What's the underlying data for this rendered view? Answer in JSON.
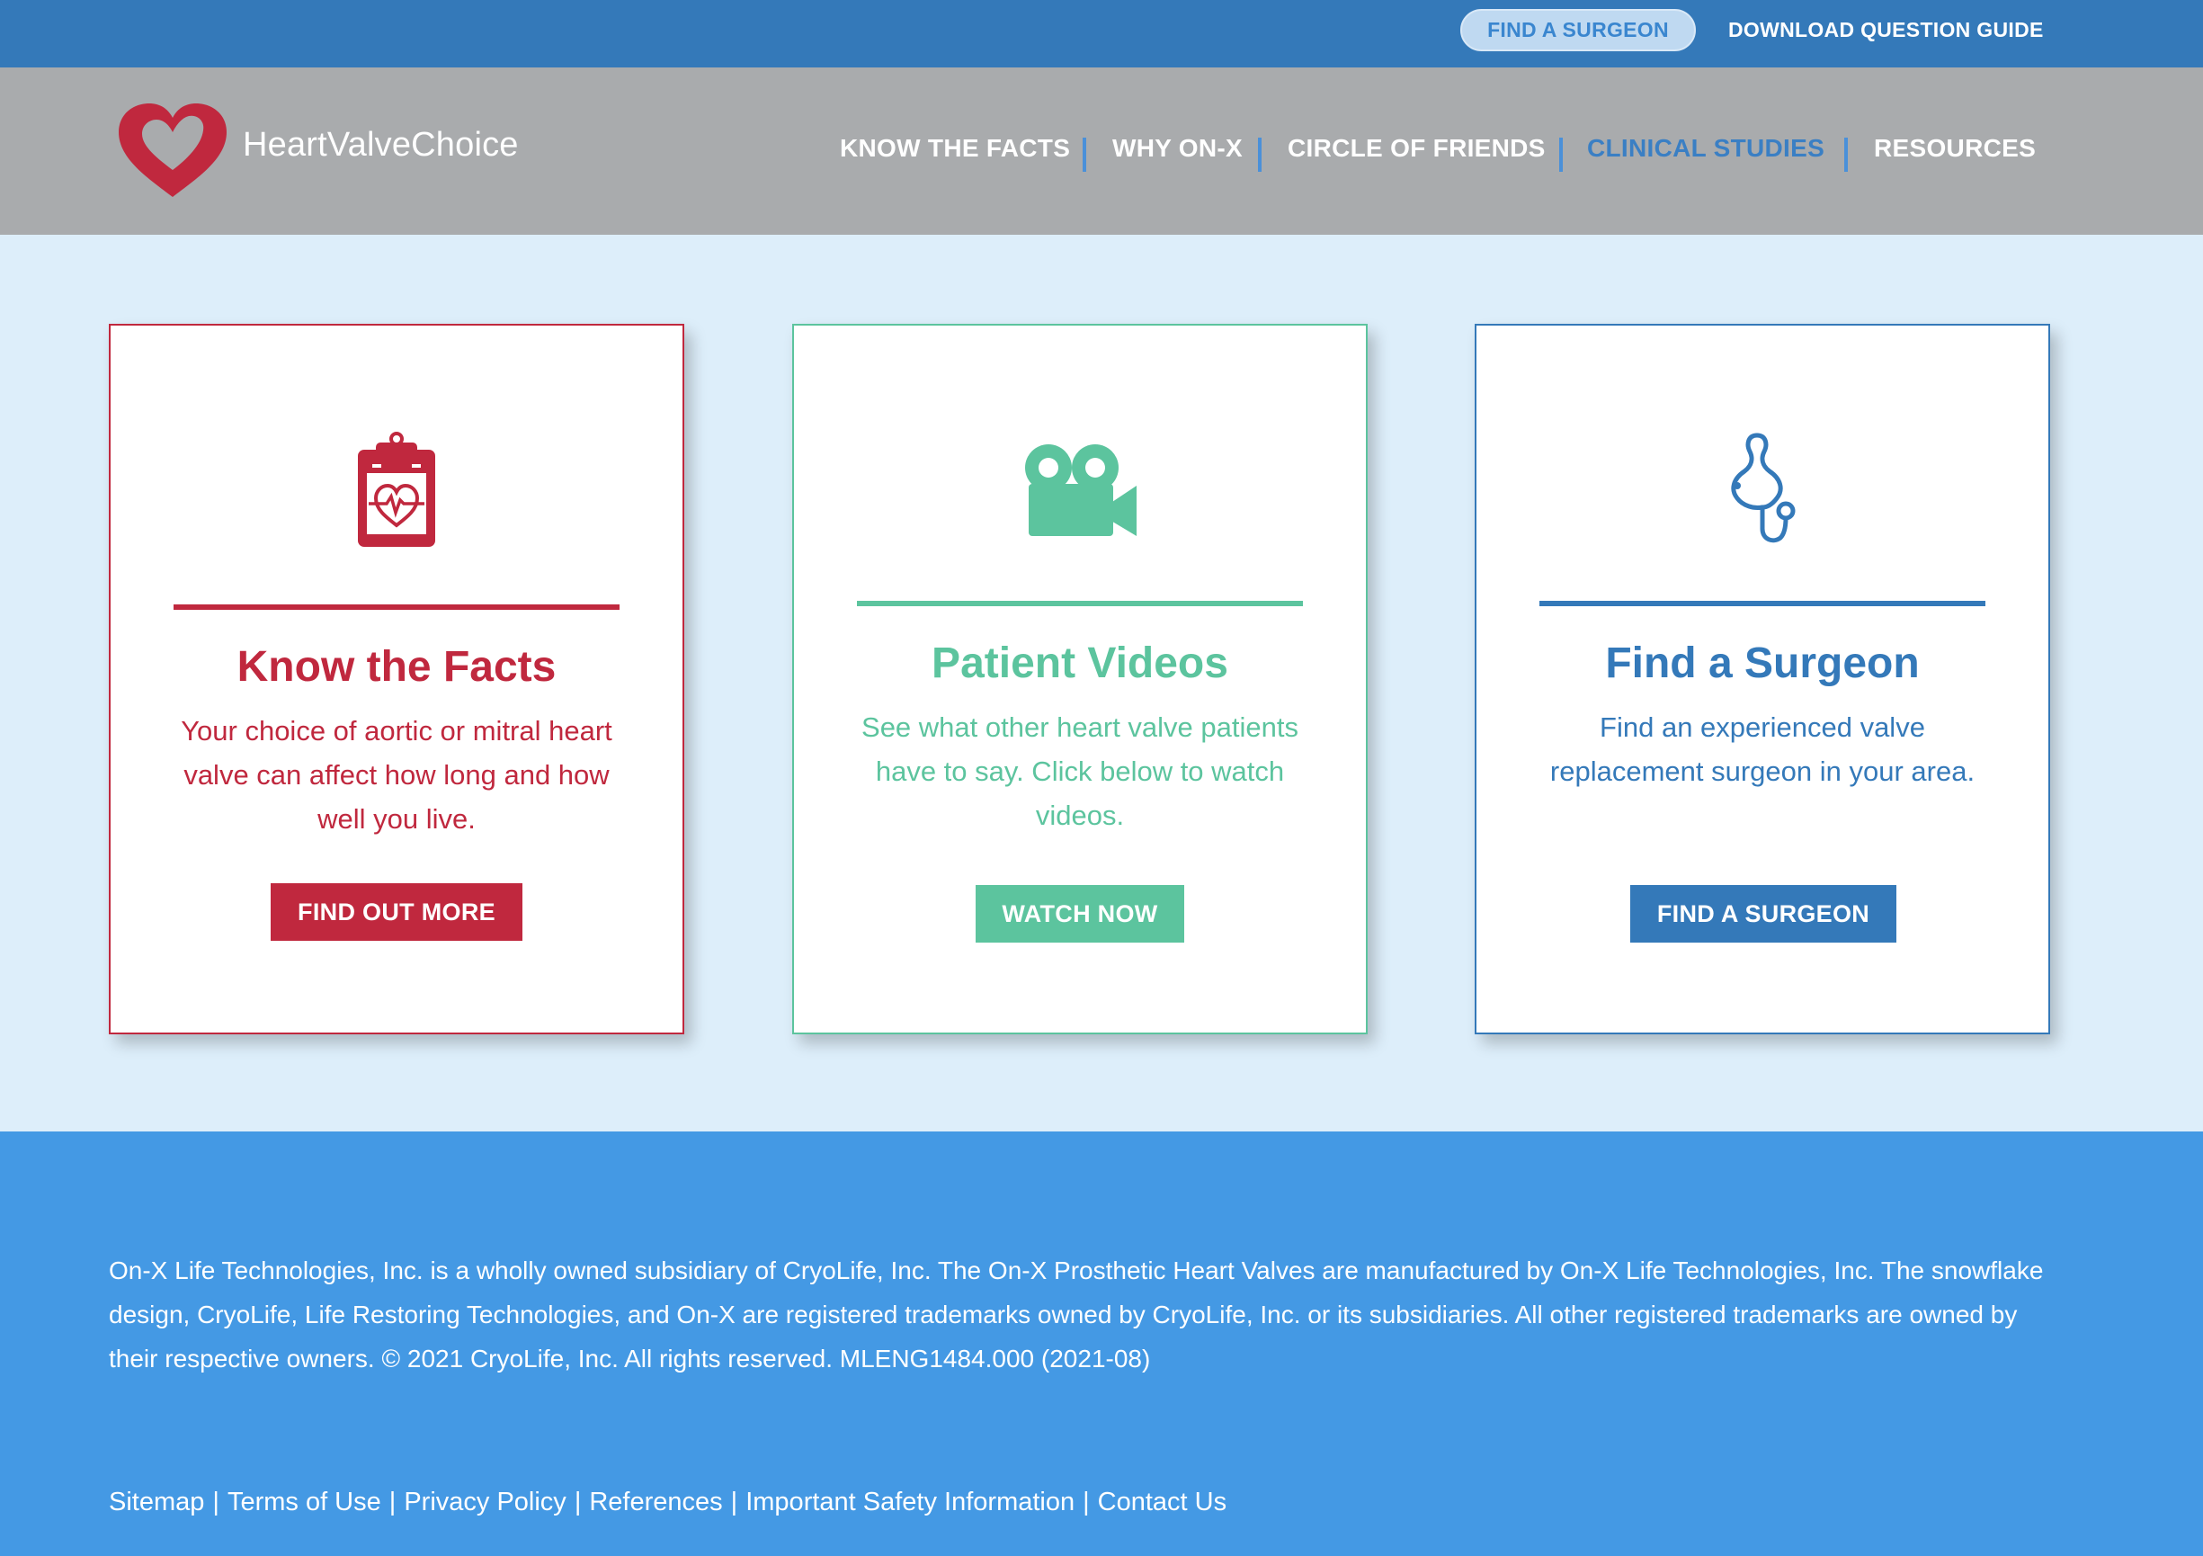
{
  "utility_bar": {
    "find_surgeon": "FIND A SURGEON",
    "download_guide": "DOWNLOAD QUESTION GUIDE"
  },
  "header": {
    "logo_text": "HeartValveChoice",
    "nav": [
      {
        "label": "KNOW THE FACTS",
        "active": false
      },
      {
        "label": "WHY ON-X",
        "active": false
      },
      {
        "label": "CIRCLE OF FRIENDS",
        "active": false
      },
      {
        "label": "CLINICAL STUDIES",
        "active": true
      },
      {
        "label": "RESOURCES",
        "active": false
      }
    ]
  },
  "cards": [
    {
      "icon": "clipboard-heart-icon",
      "title": "Know the Facts",
      "body": "Your choice of aortic or mitral heart valve can affect how long and how well you live.",
      "button": "FIND OUT MORE",
      "color": "#c0283e"
    },
    {
      "icon": "video-camera-icon",
      "title": "Patient Videos",
      "body": "See what other heart valve  patients have to say. Click below to watch videos.",
      "button": "WATCH NOW",
      "color": "#5cc49e"
    },
    {
      "icon": "stethoscope-icon",
      "title": "Find a Surgeon",
      "body": "Find an experienced valve replacement surgeon in your area.",
      "button": "FIND A SURGEON",
      "color": "#3479b9"
    }
  ],
  "footer": {
    "legal": "On-X Life Technologies, Inc. is a wholly owned subsidiary of CryoLife, Inc. The On-X Prosthetic Heart Valves are manufactured by On-X Life Technologies, Inc. The snowflake design, CryoLife, Life Restoring Technologies, and On-X are registered trademarks owned by CryoLife, Inc. or its subsidiaries. All other registered trademarks are owned by their respective owners. © 2021 CryoLife, Inc. All rights reserved. MLENG1484.000 (2021-08)",
    "links": [
      "Sitemap",
      "Terms of Use",
      "Privacy Policy",
      "References",
      "Important Safety Information",
      "Contact Us"
    ],
    "separator": "|"
  },
  "colors": {
    "utility_blue": "#3479b9",
    "header_gray": "#a9abad",
    "page_bg": "#ddeefa",
    "footer_blue": "#4499e4",
    "brand_red": "#c0283e",
    "brand_green": "#5cc49e"
  }
}
